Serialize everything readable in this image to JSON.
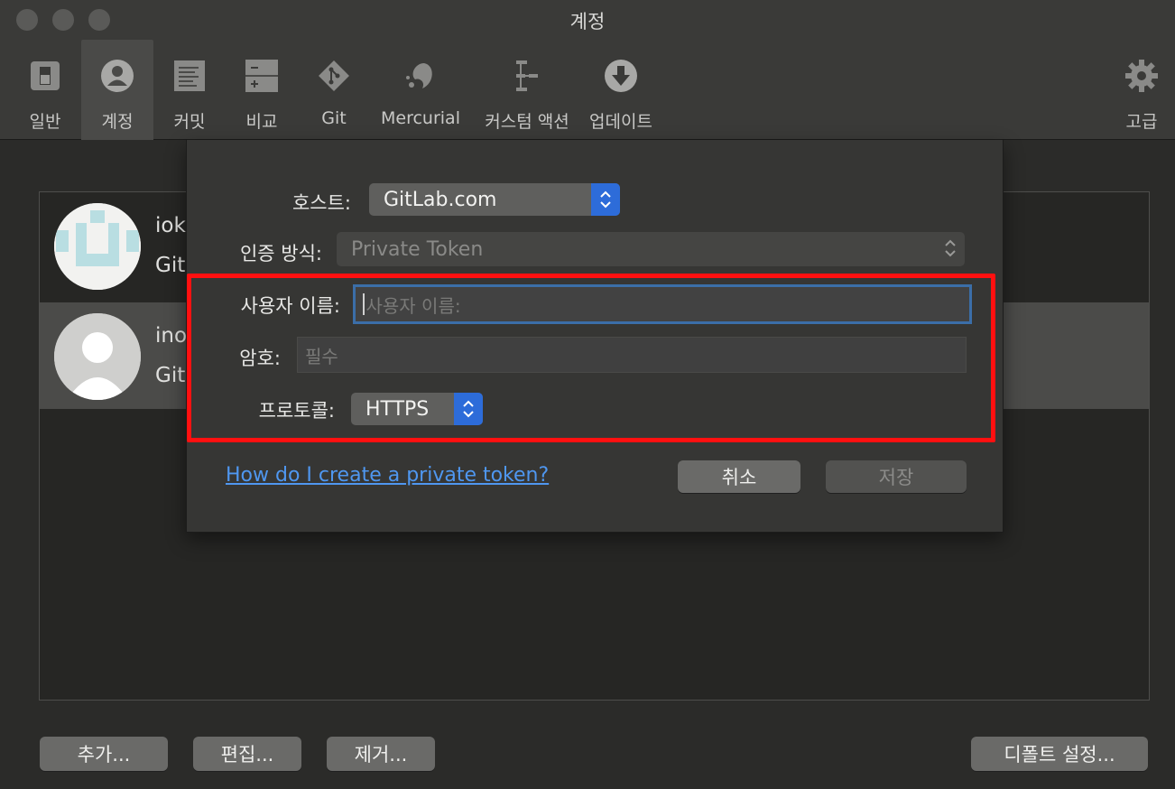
{
  "window": {
    "title": "계정"
  },
  "toolbar": {
    "items": [
      {
        "label": "일반"
      },
      {
        "label": "계정"
      },
      {
        "label": "커밋"
      },
      {
        "label": "비교"
      },
      {
        "label": "Git"
      },
      {
        "label": "Mercurial"
      },
      {
        "label": "커스텀 액션"
      },
      {
        "label": "업데이트"
      },
      {
        "label": "고급"
      }
    ],
    "active": "계정"
  },
  "accounts": [
    {
      "name": "iok",
      "sub": "Git"
    },
    {
      "name": "ino",
      "sub": "Git"
    }
  ],
  "bottom": {
    "add": "추가...",
    "edit": "편집...",
    "remove": "제거...",
    "default": "디폴트 설정..."
  },
  "dialog": {
    "host_label": "호스트:",
    "host_value": "GitLab.com",
    "auth_label": "인증 방식:",
    "auth_value": "Private Token",
    "username_label": "사용자 이름:",
    "username_placeholder": "사용자 이름:",
    "password_label": "암호:",
    "password_placeholder": "필수",
    "protocol_label": "프로토콜:",
    "protocol_value": "HTTPS",
    "link": "How do I create a private token?",
    "cancel": "취소",
    "save": "저장"
  },
  "colors": {
    "accent": "#2d6cd9",
    "highlight": "#ff1010",
    "link": "#4f97f0"
  }
}
